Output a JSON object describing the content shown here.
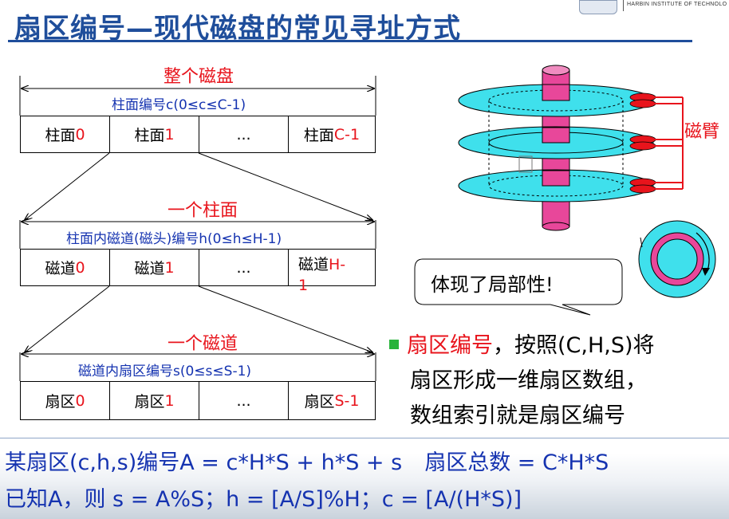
{
  "title": "扇区编号—现代磁盘的常见寻址方式",
  "logo": {
    "text": "HARBIN INSTITUTE OF TECHNOLO"
  },
  "level1": {
    "heading": "整个磁盘",
    "sub": "柱面编号c(0≤c≤C-1)",
    "cells": [
      {
        "text": "柱面",
        "suffix": "0"
      },
      {
        "text": "柱面",
        "suffix": "1"
      },
      {
        "text": "...",
        "suffix": ""
      },
      {
        "text": "柱面",
        "suffix": "C-1"
      }
    ]
  },
  "level2": {
    "heading": "一个柱面",
    "sub": "柱面内磁道(磁头)编号h(0≤h≤H-1)",
    "cells": [
      {
        "text": "磁道",
        "suffix": "0"
      },
      {
        "text": "磁道",
        "suffix": "1"
      },
      {
        "text": "...",
        "suffix": ""
      },
      {
        "text": "磁道",
        "suffix": "H-",
        "suffix2": "1"
      }
    ]
  },
  "level3": {
    "heading": "一个磁道",
    "sub": "磁道内扇区编号s(0≤s≤S-1)",
    "cells": [
      {
        "text": "扇区",
        "suffix": "0"
      },
      {
        "text": "扇区",
        "suffix": "1"
      },
      {
        "text": "...",
        "suffix": ""
      },
      {
        "text": "扇区",
        "suffix": "S-1"
      }
    ]
  },
  "disk": {
    "arm_label": "磁臂"
  },
  "callout": "体现了局部性!",
  "bullet": {
    "red_part": "扇区编号",
    "line1_rest": "，按照(C,H,S)将",
    "line2": "扇区形成一维扇区数组，",
    "line3": "数组索引就是扇区编号"
  },
  "formula1": {
    "a": "某扇区(c,h,s)编号A = c*H*S + h*S + s",
    "b": "扇区总数 = C*H*S"
  },
  "formula2": {
    "a": "已知A，则 s = A%S；h = [A/S]%H；c = [A/(H*S)]"
  },
  "colors": {
    "title": "#1f4e9b",
    "red": "#e8141c",
    "blue": "#1533b0",
    "cyan": "#3fe0ec",
    "magenta": "#e8479a",
    "bullet": "#27b33a"
  }
}
